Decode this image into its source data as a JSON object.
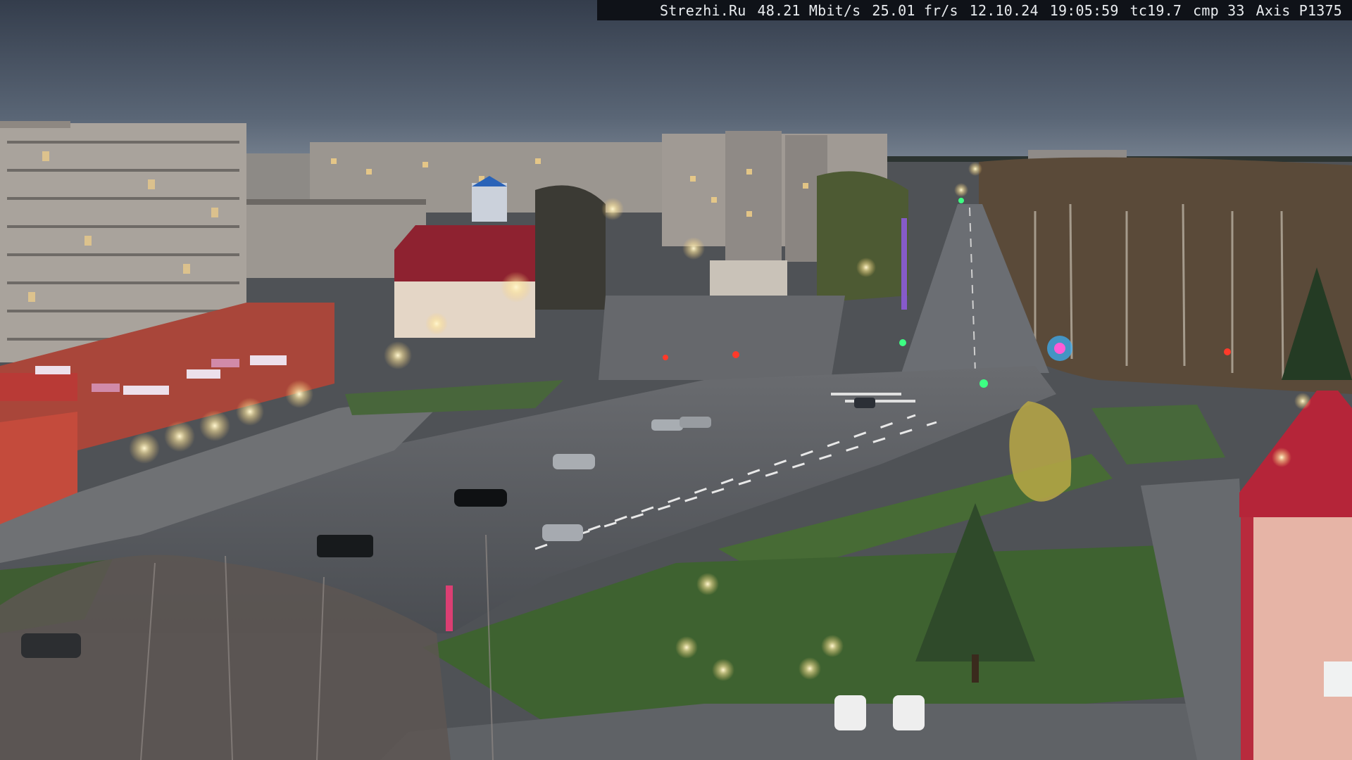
{
  "overlay": {
    "site": "Strezhi.Ru",
    "bitrate": "48.21 Mbit/s",
    "framerate": "25.01 fr/s",
    "date": "12.10.24",
    "time": "19:05:59",
    "tc": "tc19.7",
    "cmp": "cmp 33",
    "camera_model": "Axis P1375"
  },
  "storefront_signs": [
    "",
    "",
    "",
    ""
  ],
  "colors": {
    "sky_top": "#3b4556",
    "sky_bottom": "#6a7584",
    "asphalt": "#5a5d62",
    "grass": "#3d5a34",
    "brick": "#b0493a",
    "roof_red": "#9e2635",
    "streetlight": "#fff3c6"
  }
}
